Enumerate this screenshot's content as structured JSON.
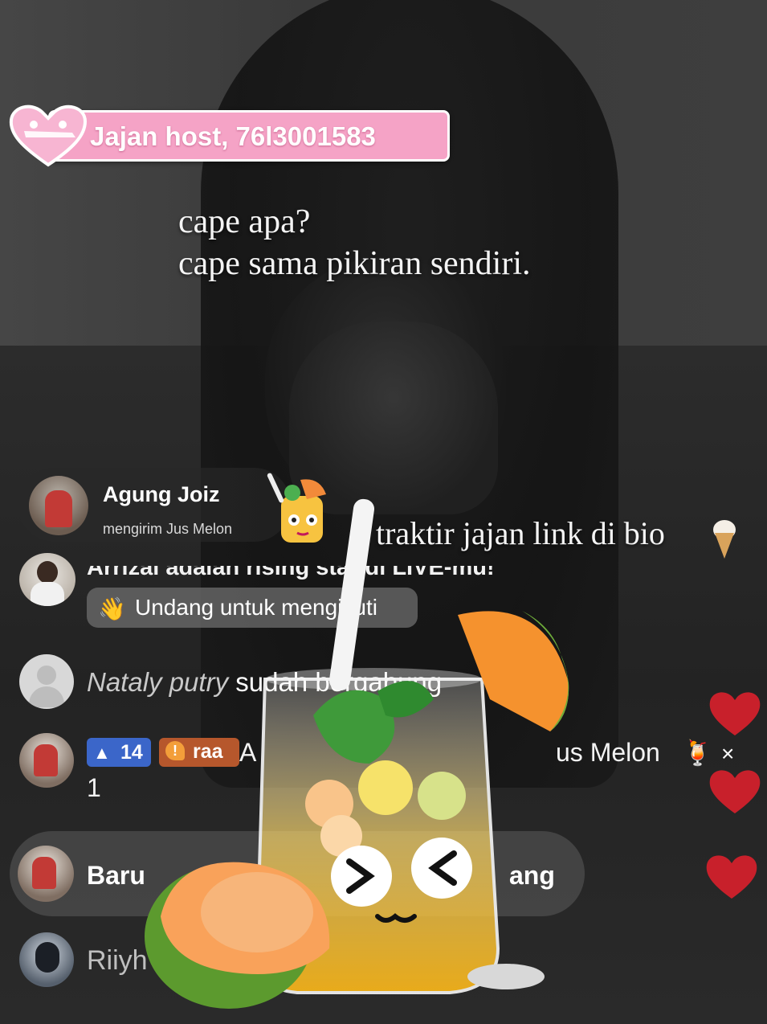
{
  "host_banner": {
    "text": "Jajan host, 76l3001583"
  },
  "overlay": {
    "quote_line1": "cape apa?",
    "quote_line2": "cape sama pikiran sendiri.",
    "promo": "traktir jajan link di bio"
  },
  "gift_notice": {
    "user": "Agung Joiz",
    "action": "mengirim Jus Melon"
  },
  "chat": {
    "rising": "Arrizal adalah rising star di LIVE-mu!",
    "invite_button": "Undang untuk mengikuti",
    "join_user": "Nataly putry",
    "join_text": " sudah bergabung",
    "gift_line": {
      "level": "14",
      "fan_badge": "raa",
      "text_a": "A",
      "text_b": "us Melon",
      "x": "×",
      "count": "1"
    },
    "new_joiner_a": "Baru",
    "new_joiner_b": "ang",
    "last_user": "Riiyh"
  },
  "icons": {
    "wave": "waving-hand-icon",
    "heart": "heart-icon",
    "icecream": "ice-cream-icon",
    "gift": "melon-juice-icon"
  },
  "colors": {
    "host_pink": "#f5a3c6",
    "heart_red": "#c8202b",
    "level_blue": "#3b66c9",
    "fan_orange": "#b6572c"
  }
}
